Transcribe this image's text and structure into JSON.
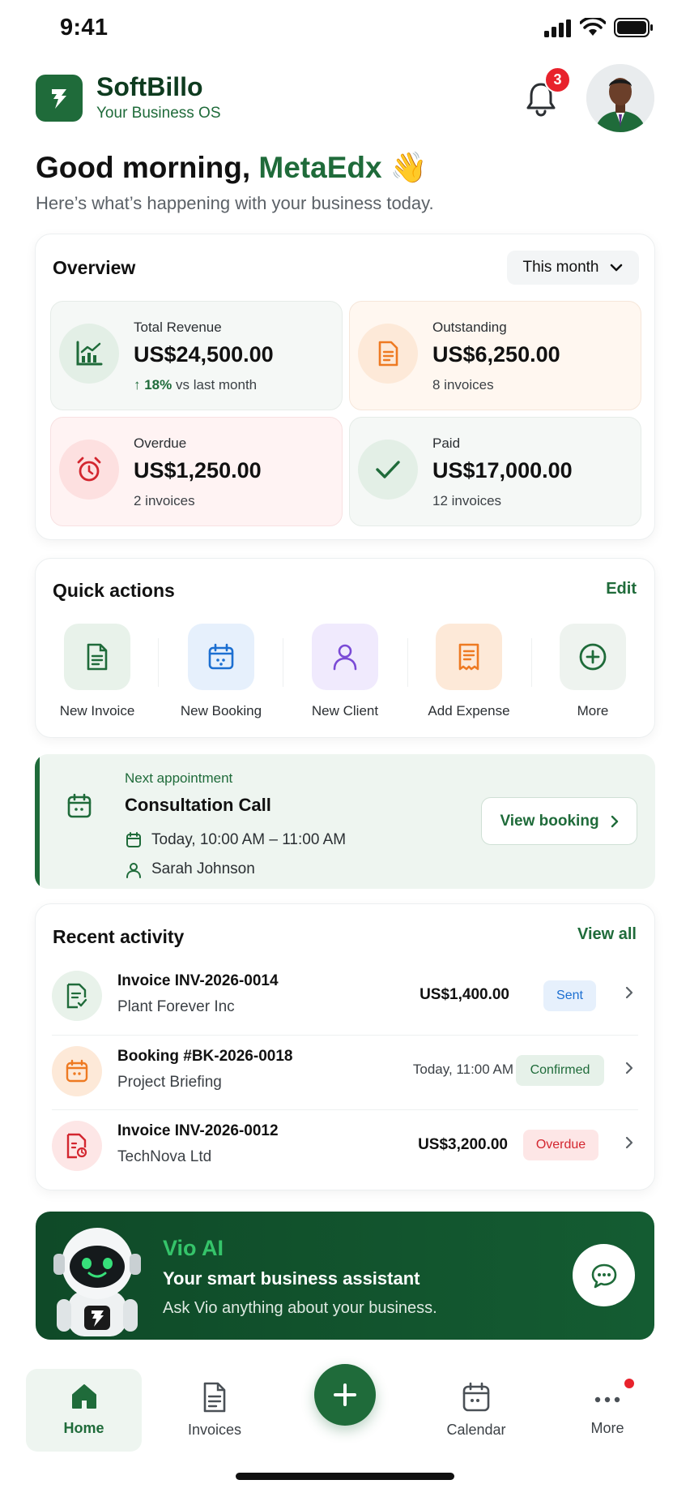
{
  "status_bar": {
    "time": "9:41"
  },
  "header": {
    "brand": "SoftBillo",
    "tagline": "Your Business OS",
    "notification_count": "3"
  },
  "greeting": {
    "prefix": "Good morning,",
    "name": "MetaEdx",
    "emoji": "👋",
    "subtitle": "Here’s what’s happening with your business today."
  },
  "overview": {
    "title": "Overview",
    "period": "This month",
    "stats": [
      {
        "label": "Total Revenue",
        "value": "US$24,500.00",
        "change": "↑ 18%",
        "change_suffix": "vs last month",
        "icon": "chart-icon"
      },
      {
        "label": "Outstanding",
        "value": "US$6,250.00",
        "note": "8 invoices",
        "icon": "document-icon"
      },
      {
        "label": "Overdue",
        "value": "US$1,250.00",
        "note": "2 invoices",
        "icon": "alarm-clock-icon"
      },
      {
        "label": "Paid",
        "value": "US$17,000.00",
        "note": "12 invoices",
        "icon": "check-icon"
      }
    ]
  },
  "quick_actions": {
    "title": "Quick actions",
    "edit_label": "Edit",
    "items": [
      {
        "label": "New Invoice",
        "icon": "invoice-icon"
      },
      {
        "label": "New Booking",
        "icon": "calendar-icon"
      },
      {
        "label": "New Client",
        "icon": "user-icon"
      },
      {
        "label": "Add Expense",
        "icon": "receipt-icon"
      },
      {
        "label": "More",
        "icon": "plus-circle-icon"
      }
    ]
  },
  "appointment": {
    "kicker": "Next appointment",
    "title": "Consultation Call",
    "time": "Today, 10:00 AM – 11:00 AM",
    "person": "Sarah Johnson",
    "button": "View booking"
  },
  "recent": {
    "title": "Recent activity",
    "view_all": "View all",
    "items": [
      {
        "title": "Invoice INV-2026-0014",
        "subtitle": "Plant Forever Inc",
        "amount": "US$1,400.00",
        "status": "Sent",
        "status_color": "#1c6fd1"
      },
      {
        "title": "Booking #BK-2026-0018",
        "subtitle": "Project Briefing",
        "amount": "Today, 11:00 AM",
        "status": "Confirmed",
        "status_color": "#1f6b3a"
      },
      {
        "title": "Invoice INV-2026-0012",
        "subtitle": "TechNova Ltd",
        "amount": "US$3,200.00",
        "status": "Overdue",
        "status_color": "#d3262f"
      }
    ]
  },
  "ai_banner": {
    "title": "Vio AI",
    "headline": "Your smart business assistant",
    "subtitle": "Ask Vio anything about your business."
  },
  "bottom_nav": {
    "items": [
      {
        "label": "Home",
        "active": true
      },
      {
        "label": "Invoices"
      },
      {
        "label": "Calendar"
      },
      {
        "label": "More"
      }
    ]
  },
  "colors": {
    "brand_green": "#1f6b3a",
    "dark_green": "#0f4a28",
    "danger": "#e8222c"
  }
}
